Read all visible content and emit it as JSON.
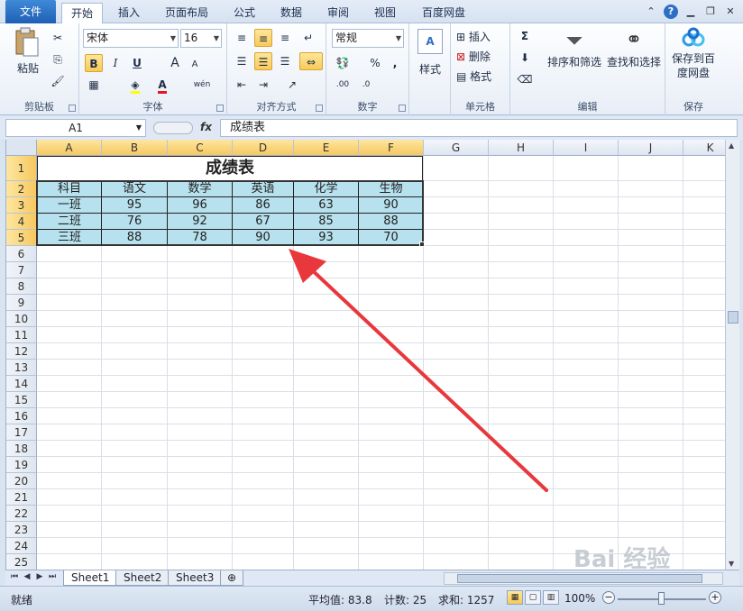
{
  "ribbon_tabs": {
    "file": "文件",
    "home": "开始",
    "insert": "插入",
    "page_layout": "页面布局",
    "formulas": "公式",
    "data": "数据",
    "review": "审阅",
    "view": "视图",
    "baidu": "百度网盘"
  },
  "clipboard": {
    "paste": "粘贴",
    "label": "剪贴板"
  },
  "font": {
    "name": "宋体",
    "size": "16",
    "bold": "B",
    "italic": "I",
    "underline": "U",
    "grow": "A",
    "shrink": "A",
    "label": "字体",
    "font_color": "#e3171f",
    "fill_color": "#ffff00"
  },
  "alignment": {
    "label": "对齐方式"
  },
  "number": {
    "format": "常规",
    "percent": "%",
    "comma": ",",
    "label": "数字"
  },
  "styles": {
    "button": "样式"
  },
  "cells": {
    "insert": "插入",
    "delete": "删除",
    "format": "格式",
    "label": "单元格"
  },
  "editing": {
    "sigma": "Σ",
    "sort_filter": "排序和筛选",
    "find_select": "查找和选择",
    "label": "编辑"
  },
  "save": {
    "button_line1": "保存到百",
    "button_line2": "度网盘",
    "label": "保存"
  },
  "formula_bar": {
    "name_box": "A1",
    "fx": "fx",
    "content": "成绩表"
  },
  "columns": [
    "A",
    "B",
    "C",
    "D",
    "E",
    "F",
    "G",
    "H",
    "I",
    "J",
    "K"
  ],
  "rows": [
    "1",
    "2",
    "3",
    "4",
    "5",
    "6",
    "7",
    "8",
    "9",
    "10",
    "11",
    "12",
    "13",
    "14",
    "15",
    "16",
    "17",
    "18",
    "19",
    "20",
    "21",
    "22",
    "23",
    "24",
    "25"
  ],
  "table": {
    "title": "成绩表",
    "headers": [
      "科目",
      "语文",
      "数学",
      "英语",
      "化学",
      "生物"
    ],
    "data": [
      [
        "一班",
        "95",
        "96",
        "86",
        "63",
        "90"
      ],
      [
        "二班",
        "76",
        "92",
        "67",
        "85",
        "88"
      ],
      [
        "三班",
        "88",
        "78",
        "90",
        "93",
        "70"
      ]
    ],
    "fill_color": "#b7e1ee"
  },
  "sheet_tabs": [
    "Sheet1",
    "Sheet2",
    "Sheet3"
  ],
  "status": {
    "ready": "就绪",
    "average": "平均值: 83.8",
    "count": "计数: 25",
    "sum": "求和: 1257",
    "zoom": "100%"
  },
  "overlay": {
    "arrow_color": "#e8383d",
    "watermark": "Bai 经验"
  }
}
